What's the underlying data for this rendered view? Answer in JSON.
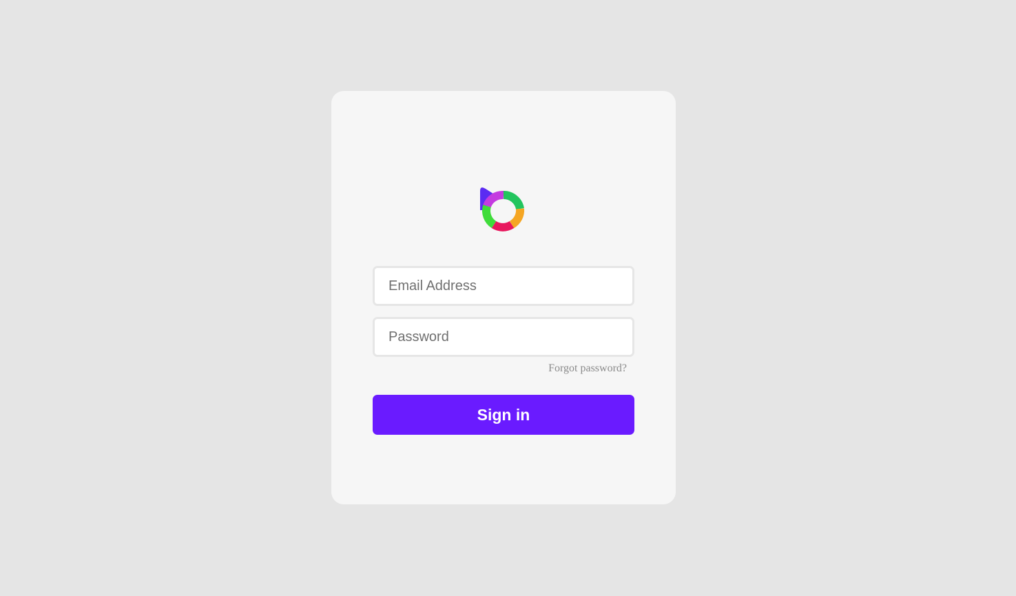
{
  "logo": {
    "icon": "brand-logo-icon"
  },
  "form": {
    "email_placeholder": "Email Address",
    "password_placeholder": "Password",
    "forgot_label": "Forgot password?",
    "signin_label": "Sign in"
  },
  "colors": {
    "background": "#e5e5e5",
    "card": "#f6f6f6",
    "accent": "#6a1bff",
    "logo": [
      "#5b2bf2",
      "#c43be0",
      "#22c55e",
      "#f5a623",
      "#e8175d",
      "#3fdc3a"
    ]
  }
}
